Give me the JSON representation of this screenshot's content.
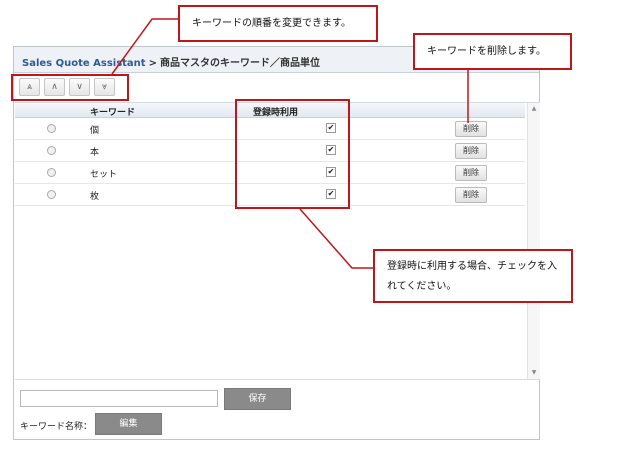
{
  "breadcrumb": {
    "app": "Sales Quote Assistant",
    "separator": ">",
    "page": "商品マスタのキーワード／商品単位"
  },
  "order_buttons": [
    {
      "icon": "double-up-icon",
      "glyph": "⩓"
    },
    {
      "icon": "up-icon",
      "glyph": "∧"
    },
    {
      "icon": "down-icon",
      "glyph": "∨"
    },
    {
      "icon": "double-down-icon",
      "glyph": "⩔"
    }
  ],
  "table": {
    "headers": {
      "keyword": "キーワード",
      "use_on_register": "登録時利用"
    },
    "rows": [
      {
        "keyword": "個",
        "checked": true,
        "delete_label": "削除"
      },
      {
        "keyword": "本",
        "checked": true,
        "delete_label": "削除"
      },
      {
        "keyword": "セット",
        "checked": true,
        "delete_label": "削除"
      },
      {
        "keyword": "枚",
        "checked": true,
        "delete_label": "削除"
      }
    ]
  },
  "form": {
    "input_value": "",
    "save_label": "保存",
    "name_label": "キーワード名称：",
    "edit_label": "編集"
  },
  "callouts": {
    "reorder": "キーワードの順番を変更できます。",
    "delete": "キーワードを削除します。",
    "register": "登録時に利用する場合、チェックを入れてください。"
  },
  "colors": {
    "annotation": "#c0161a",
    "app_link": "#2c5a9a"
  }
}
